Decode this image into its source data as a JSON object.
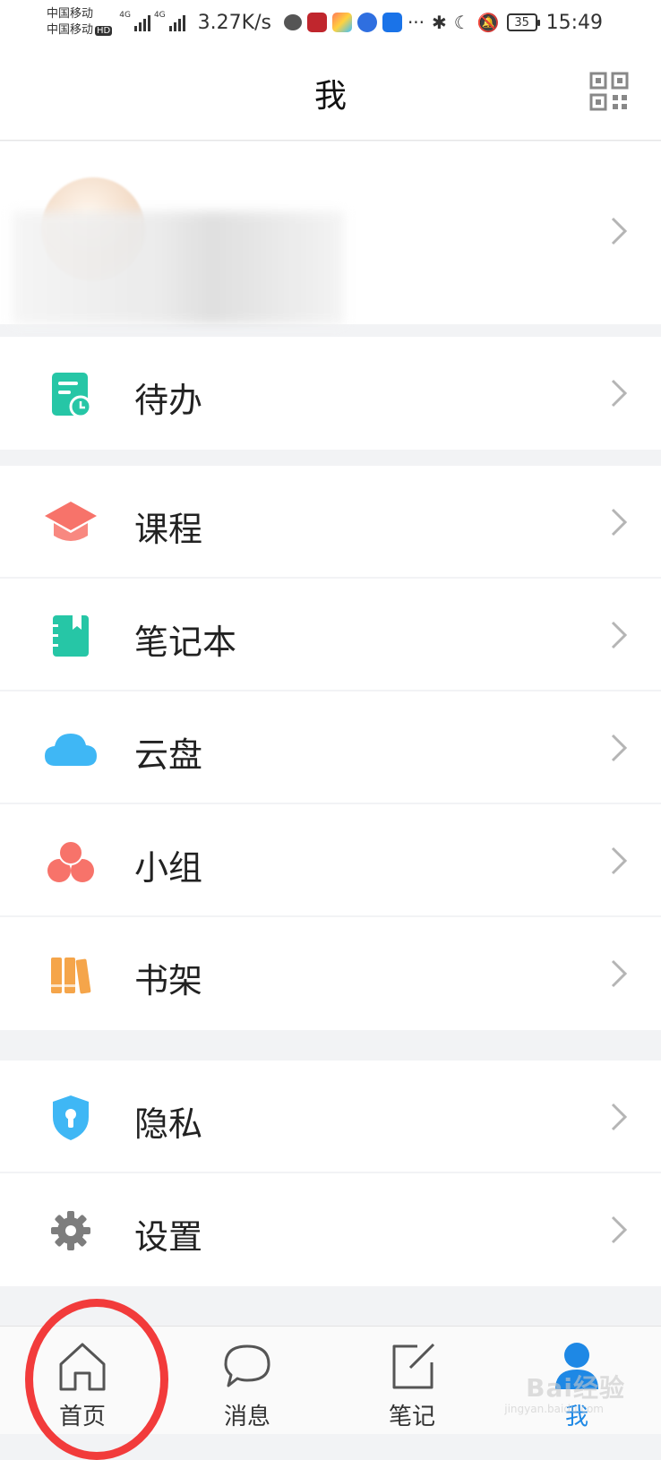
{
  "status_bar": {
    "carrier_1": "中国移动",
    "carrier_2": "中国移动",
    "hd_tag": "HD",
    "network_tag_1": "4G",
    "network_tag_2": "4G",
    "net_speed": "3.27K/s",
    "more": "···",
    "battery": "35",
    "time": "15:49"
  },
  "header": {
    "title": "我"
  },
  "menu_groups": [
    {
      "items": [
        {
          "label": "待办",
          "icon": "todo-icon",
          "color": "#26c6a6"
        }
      ]
    },
    {
      "items": [
        {
          "label": "课程",
          "icon": "course-cap-icon",
          "color": "#f7736a"
        },
        {
          "label": "笔记本",
          "icon": "notebook-icon",
          "color": "#26c6a6"
        },
        {
          "label": "云盘",
          "icon": "cloud-icon",
          "color": "#3fb7f5"
        },
        {
          "label": "小组",
          "icon": "group-icon",
          "color": "#f7736a"
        },
        {
          "label": "书架",
          "icon": "bookshelf-icon",
          "color": "#f5a54a"
        }
      ]
    },
    {
      "items": [
        {
          "label": "隐私",
          "icon": "shield-lock-icon",
          "color": "#3fb7f5"
        },
        {
          "label": "设置",
          "icon": "gear-icon",
          "color": "#7d7d7d"
        }
      ]
    }
  ],
  "tab_bar": {
    "tabs": [
      {
        "label": "首页",
        "icon": "home-icon",
        "active": false
      },
      {
        "label": "消息",
        "icon": "message-icon",
        "active": false
      },
      {
        "label": "笔记",
        "icon": "note-edit-icon",
        "active": false
      },
      {
        "label": "我",
        "icon": "profile-icon",
        "active": true
      }
    ],
    "active_color": "#1e88e5"
  },
  "watermark": {
    "text": "Bai经验",
    "sub": "jingyan.baidu.com"
  },
  "colors": {
    "annotation_circle": "#f23b3b",
    "background": "#f2f3f5"
  }
}
